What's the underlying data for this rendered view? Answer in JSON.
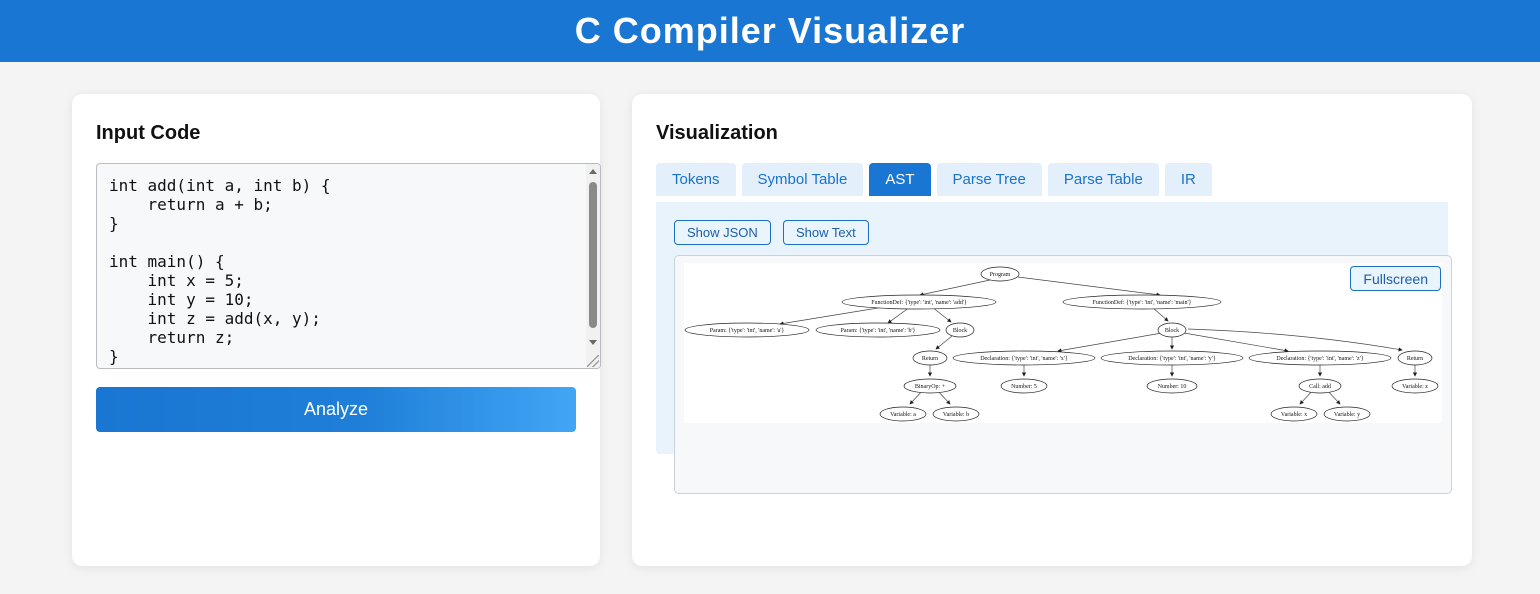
{
  "header": {
    "title": "C Compiler Visualizer"
  },
  "input": {
    "title": "Input Code",
    "code": "int add(int a, int b) {\n    return a + b;\n}\n\nint main() {\n    int x = 5;\n    int y = 10;\n    int z = add(x, y);\n    return z;\n}",
    "analyze_label": "Analyze"
  },
  "visualization": {
    "title": "Visualization",
    "tabs": [
      {
        "label": "Tokens"
      },
      {
        "label": "Symbol Table"
      },
      {
        "label": "AST",
        "active": true
      },
      {
        "label": "Parse Tree"
      },
      {
        "label": "Parse Table"
      },
      {
        "label": "IR"
      }
    ],
    "show_json_label": "Show JSON",
    "show_text_label": "Show Text",
    "fullscreen_label": "Fullscreen",
    "ast_nodes": {
      "program": "Program",
      "func_add": "FunctionDef: {'type': 'int', 'name': 'add'}",
      "func_main": "FunctionDef: {'type': 'int', 'name': 'main'}",
      "param_a": "Param: {'type': 'int', 'name': 'a'}",
      "param_b": "Param: {'type': 'int', 'name': 'b'}",
      "block_add": "Block",
      "block_main": "Block",
      "return_add": "Return",
      "binop": "BinaryOp: +",
      "var_a": "Variable: a",
      "var_b": "Variable: b",
      "decl_x": "Declaration: {'type': 'int', 'name': 'x'}",
      "decl_y": "Declaration: {'type': 'int', 'name': 'y'}",
      "decl_z": "Declaration: {'type': 'int', 'name': 'z'}",
      "return_main": "Return",
      "num_5": "Number: 5",
      "num_10": "Number: 10",
      "call_add": "Call: add",
      "var_z": "Variable: z",
      "var_x": "Variable: x",
      "var_y": "Variable: y"
    }
  },
  "colors": {
    "primary": "#1976d2",
    "tab_bg": "#e3f0fb",
    "panel_bg": "#e8f3fc"
  },
  "icons": {
    "scroll_up": "triangle-up-icon",
    "scroll_down": "triangle-down-icon",
    "resize": "resize-grip-icon"
  }
}
